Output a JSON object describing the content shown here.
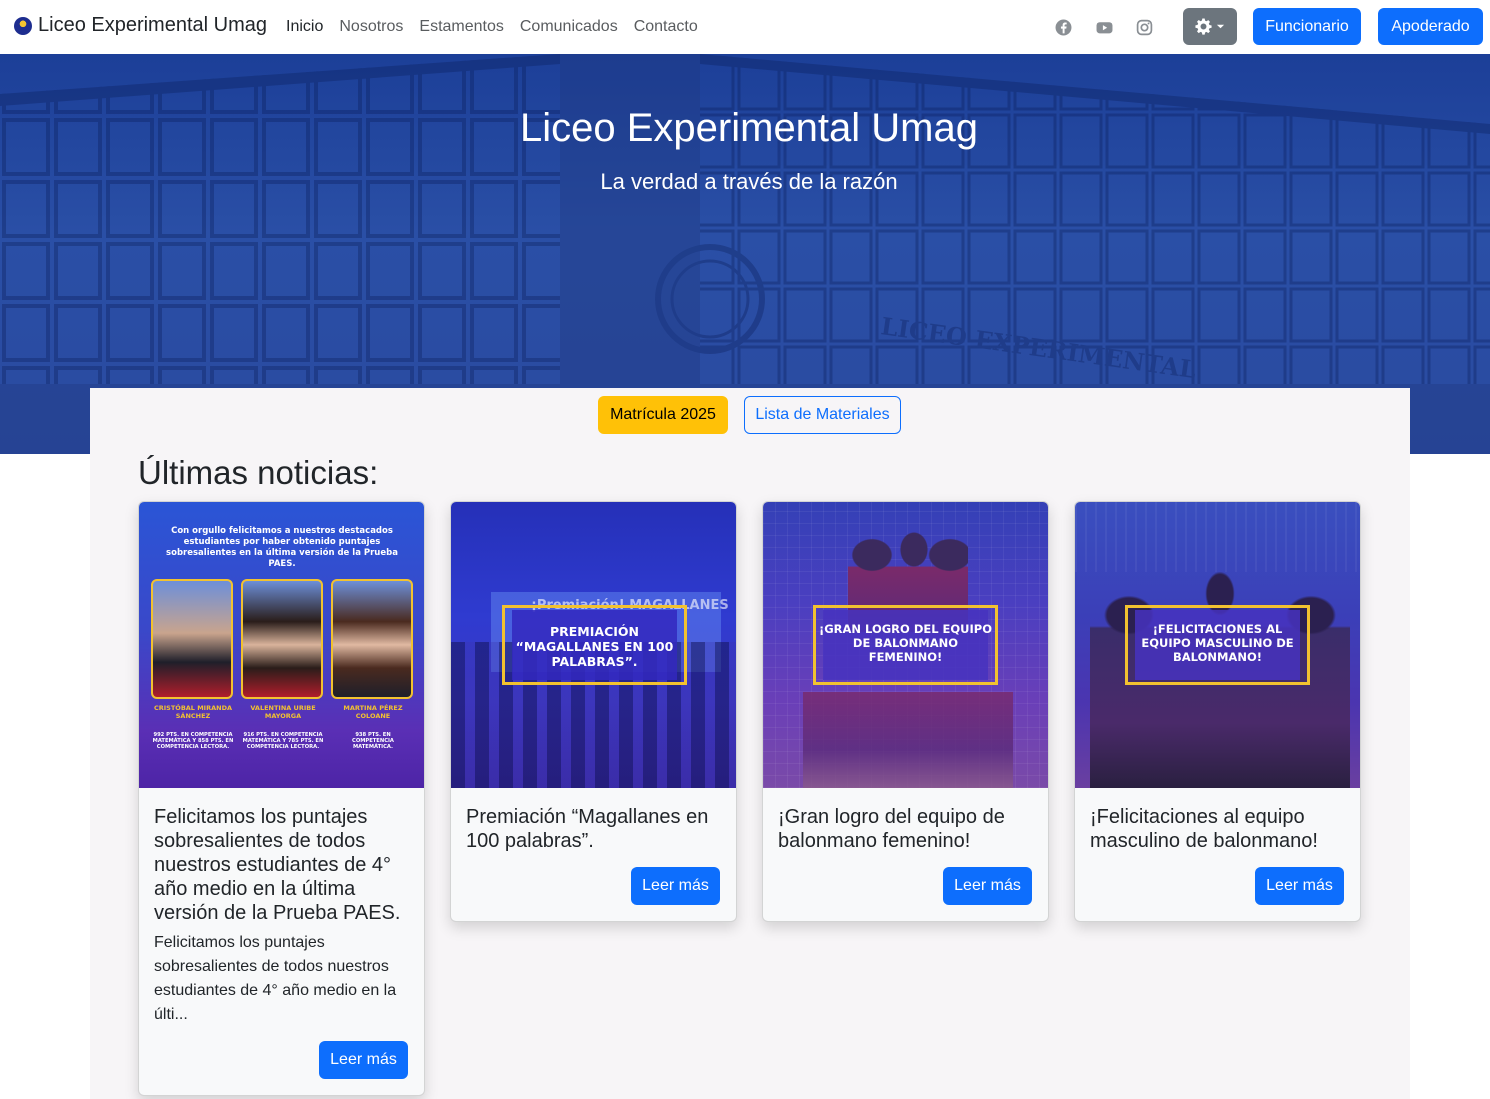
{
  "brand": {
    "name": "Liceo Experimental Umag"
  },
  "nav": {
    "links": [
      "Inicio",
      "Nosotros",
      "Estamentos",
      "Comunicados",
      "Contacto"
    ],
    "active": "Inicio",
    "social_icons": [
      "facebook-icon",
      "youtube-icon",
      "instagram-icon"
    ],
    "theme_icon": "gear-icon",
    "buttons": {
      "funcionario": "Funcionario",
      "apoderado": "Apoderado"
    }
  },
  "hero": {
    "title": "Liceo Experimental Umag",
    "subtitle": "La verdad a través de la razón",
    "building_sign": "LICEO EXPERIMENTAL"
  },
  "actions": {
    "matricula": "Matrícula 2025",
    "materiales": "Lista de Materiales"
  },
  "news": {
    "heading": "Últimas noticias:",
    "read_more": "Leer más",
    "cards": [
      {
        "title": "Felicitamos los puntajes sobresalientes de todos nuestros estudiantes de 4° año medio en la última versión de la Prueba PAES.",
        "excerpt": "Felicitamos los puntajes sobresalientes de todos nuestros estudiantes de 4° año medio en la últi...",
        "image": {
          "intro": "Con orgullo felicitamos a nuestros destacados estudiantes por haber obtenido puntajes sobresalientes en la última versión de la Prueba PAES.",
          "students": [
            {
              "name": "CRISTÓBAL MIRANDA SÁNCHEZ",
              "score": "992 PTS. EN COMPETENCIA MATEMÁTICA Y 858 PTS. EN COMPETENCIA LECTORA."
            },
            {
              "name": "VALENTINA URIBE MAYORGA",
              "score": "916 PTS. EN COMPETENCIA MATEMÁTICA Y 785 PTS. EN COMPETENCIA LECTORA."
            },
            {
              "name": "MARTINA PÉREZ COLOANE",
              "score": "938 PTS. EN COMPETENCIA MATEMÁTICA."
            }
          ]
        }
      },
      {
        "title": "Premiación “Magallanes en 100 palabras”.",
        "image": {
          "overlay": "PREMIACIÓN “MAGALLANES EN 100 PALABRAS”.",
          "backdrop": "¡Premiación! MAGALLANES"
        }
      },
      {
        "title": "¡Gran logro del equipo de balonmano femenino!",
        "image": {
          "overlay": "¡GRAN LOGRO DEL EQUIPO DE BALONMANO FEMENINO!"
        }
      },
      {
        "title": "¡Felicitaciones al equipo masculino de balonmano!",
        "image": {
          "overlay": "¡FELICITACIONES AL EQUIPO MASCULINO DE BALONMANO!"
        }
      }
    ]
  },
  "colors": {
    "primary": "#0d6efd",
    "warning": "#ffc107",
    "secondary": "#6c757d",
    "hero": "#1c3f98"
  }
}
